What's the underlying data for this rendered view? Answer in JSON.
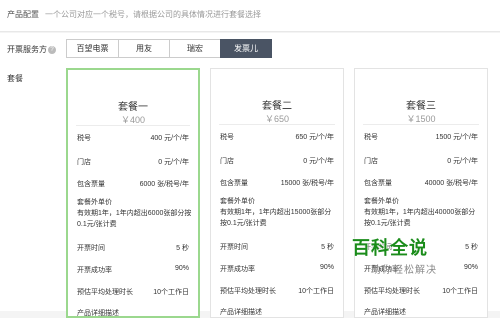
{
  "header": {
    "title": "产品配置",
    "description": "一个公司对应一个税号，请根据公司的具体情况进行套餐选择"
  },
  "service": {
    "label": "开票服务方",
    "options": [
      "百望电票",
      "用友",
      "瑞宏",
      "发票儿"
    ],
    "selected_index": 3
  },
  "plans_label": "套餐",
  "plans": [
    {
      "name": "套餐一",
      "price": "￥400",
      "selected": true,
      "fields": [
        {
          "key": "税号",
          "value": "400 元/个/年"
        },
        {
          "key": "门店",
          "value": "0 元/个/年"
        },
        {
          "key": "包含票量",
          "value": "6000 张/税号/年"
        }
      ],
      "extra_title": "套餐外单价",
      "extra_text": "有效期1年，1年内超出6000张部分按0.1元/张计费",
      "bottom_fields": [
        {
          "key": "开票时间",
          "value": "5 秒"
        },
        {
          "key": "开票成功率",
          "value": "90%"
        },
        {
          "key": "预估平均处理时长",
          "value": "10个工作日"
        }
      ],
      "footer": "产品详细描述"
    },
    {
      "name": "套餐二",
      "price": "￥650",
      "selected": false,
      "fields": [
        {
          "key": "税号",
          "value": "650 元/个/年"
        },
        {
          "key": "门店",
          "value": "0 元/个/年"
        },
        {
          "key": "包含票量",
          "value": "15000 张/税号/年"
        }
      ],
      "extra_title": "套餐外单价",
      "extra_text": "有效期1年，1年内超出15000张部分按0.1元/张计费",
      "bottom_fields": [
        {
          "key": "开票时间",
          "value": "5 秒"
        },
        {
          "key": "开票成功率",
          "value": "90%"
        },
        {
          "key": "预估平均处理时长",
          "value": "10个工作日"
        }
      ],
      "footer": "产品详细描述"
    },
    {
      "name": "套餐三",
      "price": "￥1500",
      "selected": false,
      "fields": [
        {
          "key": "税号",
          "value": "1500 元/个/年"
        },
        {
          "key": "门店",
          "value": "0 元/个/年"
        },
        {
          "key": "包含票量",
          "value": "40000 张/税号/年"
        }
      ],
      "extra_title": "套餐外单价",
      "extra_text": "有效期1年，1年内超出40000张部分按0.1元/张计费",
      "bottom_fields": [
        {
          "key": "开票时间",
          "value": "5 秒"
        },
        {
          "key": "开票成功率",
          "value": "90%"
        },
        {
          "key": "预估平均处理时长",
          "value": "10个工作日"
        }
      ],
      "footer": "产品详细描述"
    }
  ],
  "watermark": {
    "title": "百科全说",
    "subtitle": "助你轻松解决"
  },
  "colors": {
    "accent": "#4a5464",
    "selected_border": "#9bd88e",
    "watermark": "#1a8c1a"
  }
}
